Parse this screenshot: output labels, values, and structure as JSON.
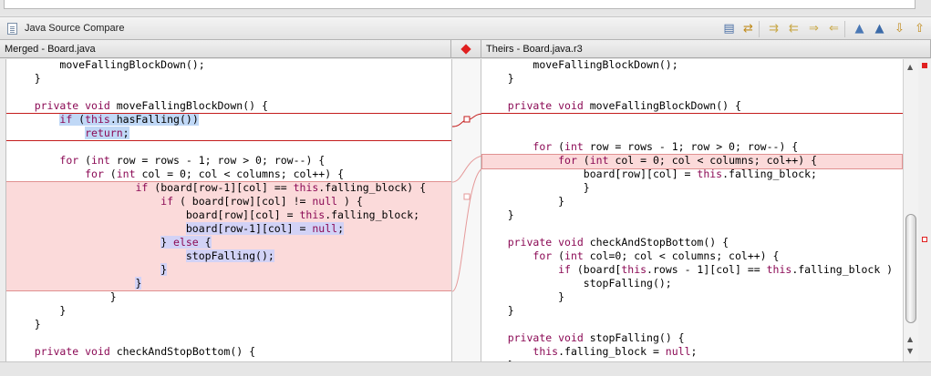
{
  "window": {
    "title": "Java Source Compare"
  },
  "toolbar": {
    "buttons": [
      {
        "name": "layout-icon",
        "glyph": "▤",
        "color": "#4a6fa5"
      },
      {
        "name": "switch-sides-icon",
        "glyph": "⇄",
        "color": "#c08a1a"
      },
      {
        "name": "copy-all-right-icon",
        "glyph": "⇉",
        "color": "#c9a94a"
      },
      {
        "name": "copy-all-left-icon",
        "glyph": "⇇",
        "color": "#c9a94a"
      },
      {
        "name": "copy-right-icon",
        "glyph": "⇒",
        "color": "#c9a94a"
      },
      {
        "name": "copy-left-icon",
        "glyph": "⇐",
        "color": "#c9a94a"
      },
      {
        "name": "next-difference-icon",
        "glyph": "▲",
        "color": "#4a78b5"
      },
      {
        "name": "previous-difference-icon",
        "glyph": "▲",
        "color": "#3b6aa8"
      },
      {
        "name": "next-change-icon",
        "glyph": "⇩",
        "color": "#c08a1a"
      },
      {
        "name": "previous-change-icon",
        "glyph": "⇧",
        "color": "#c08a1a"
      }
    ]
  },
  "left_pane": {
    "header": "Merged - Board.java",
    "lines": [
      "        moveFallingBlockDown();",
      "    }",
      "",
      "    private void moveFallingBlockDown() {",
      "        if (this.hasFalling())",
      "            return;",
      "",
      "        for (int row = rows - 1; row > 0; row--) {",
      "            for (int col = 0; col < columns; col++) {",
      "                    if (board[row-1][col] == this.falling_block) {",
      "                        if ( board[row][col] != null ) {",
      "                            board[row][col] = this.falling_block;",
      "                            board[row-1][col] = null;",
      "                        } else {",
      "                            stopFalling();",
      "                        }",
      "                    }",
      "                }",
      "        }",
      "    }",
      "",
      "    private void checkAndStopBottom() {"
    ]
  },
  "right_pane": {
    "header": "Theirs - Board.java.r3",
    "lines": [
      "        moveFallingBlockDown();",
      "    }",
      "",
      "    private void moveFallingBlockDown() {",
      "",
      "",
      "        for (int row = rows - 1; row > 0; row--) {",
      "            for (int col = 0; col < columns; col++) {",
      "                board[row][col] = this.falling_block;",
      "                }",
      "            }",
      "    }",
      "",
      "    private void checkAndStopBottom() {",
      "        for (int col=0; col < columns; col++) {",
      "            if (board[this.rows - 1][col] == this.falling_block )",
      "                stopFalling();",
      "            }",
      "    }",
      "",
      "    private void stopFalling() {",
      "        this.falling_block = null;",
      "    }"
    ]
  },
  "colors": {
    "conflict_red": "#c41d1d",
    "conflict_fill": "#fbdada",
    "selection_blue": "#c0d8f6",
    "keyword": "#8b0a55"
  },
  "keywords": [
    "private",
    "void",
    "if",
    "return",
    "for",
    "int",
    "this",
    "null",
    "else"
  ]
}
